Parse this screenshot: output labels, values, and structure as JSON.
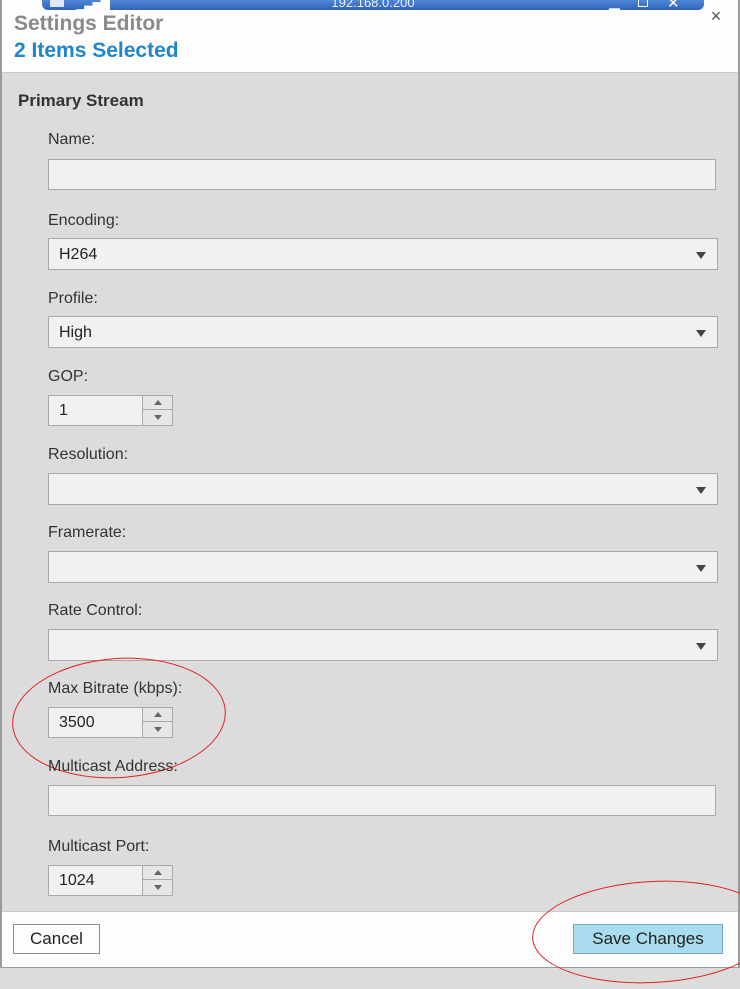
{
  "remote_bar": {
    "title": "192.168.0.200"
  },
  "dialog": {
    "title": "Settings Editor",
    "subtitle": "2 Items Selected",
    "close_symbol": "×"
  },
  "section": {
    "title": "Primary Stream"
  },
  "fields": {
    "name": {
      "label": "Name:",
      "value": "",
      "placeholder": ""
    },
    "encoding": {
      "label": "Encoding:",
      "value": "H264"
    },
    "profile": {
      "label": "Profile:",
      "value": "High"
    },
    "gop": {
      "label": "GOP:",
      "value": "1"
    },
    "resolution": {
      "label": "Resolution:",
      "value": ""
    },
    "framerate": {
      "label": "Framerate:",
      "value": ""
    },
    "rate_control": {
      "label": "Rate Control:",
      "value": ""
    },
    "max_bitrate": {
      "label": "Max Bitrate (kbps):",
      "value": "3500"
    },
    "multicast_address": {
      "label": "Multicast Address:",
      "value": "",
      "placeholder": ""
    },
    "multicast_port": {
      "label": "Multicast Port:",
      "value": "1024"
    }
  },
  "footer": {
    "cancel_label": "Cancel",
    "save_label": "Save Changes"
  },
  "colors": {
    "title_gray": "#8a8a8a",
    "subtitle_blue": "#1f86c8",
    "save_button_bg": "#a9dcef",
    "annotation_red": "#e02020"
  },
  "icons": [
    "pin-icon",
    "signal-icon",
    "minimize-icon",
    "restore-icon",
    "close-icon",
    "chevron-down-icon",
    "arrow-up-icon",
    "arrow-down-icon"
  ]
}
